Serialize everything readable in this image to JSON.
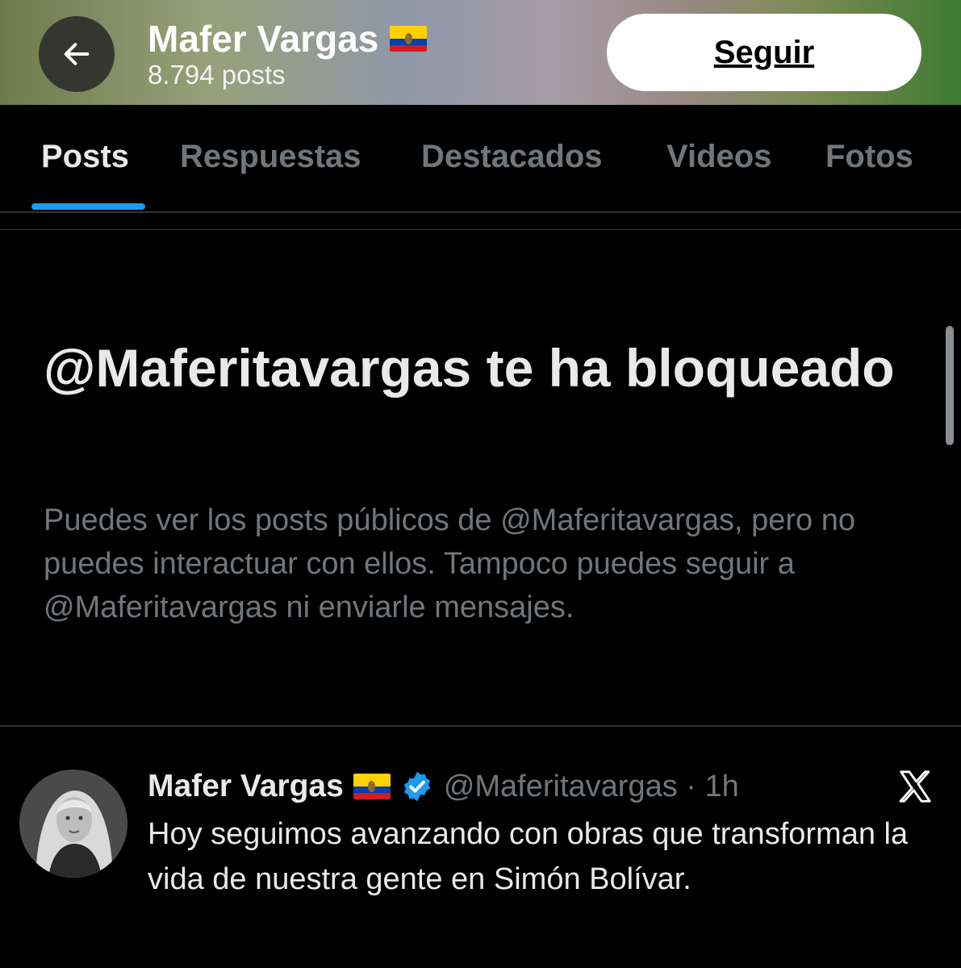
{
  "header": {
    "name": "Mafer Vargas",
    "flag": "ecuador-flag",
    "posts_count": "8.794 posts",
    "follow_label": "Seguir",
    "back_icon": "arrow-left-icon"
  },
  "tabs": [
    {
      "label": "Posts",
      "active": true
    },
    {
      "label": "Respuestas",
      "active": false
    },
    {
      "label": "Destacados",
      "active": false
    },
    {
      "label": "Videos",
      "active": false
    },
    {
      "label": "Fotos",
      "active": false
    }
  ],
  "blocked": {
    "title": "@Maferitavargas te ha bloqueado",
    "description": "Puedes ver los posts públicos de @Maferitavargas, pero no puedes interactuar con ellos. Tampoco puedes seguir a @Maferitavargas ni enviarle mensajes."
  },
  "post": {
    "author_name": "Mafer Vargas",
    "handle_time": "@Maferitavargas · 1h",
    "verified": true,
    "text": "Hoy seguimos avanzando con obras que transforman la vida de nuestra gente en Simón Bolívar.",
    "source_icon": "x-logo-icon"
  },
  "colors": {
    "accent": "#1d9bf0",
    "background": "#000000",
    "muted_text": "#71767b"
  }
}
